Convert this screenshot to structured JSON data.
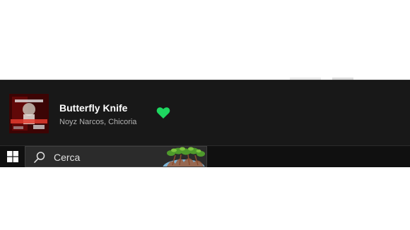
{
  "player": {
    "track_title": "Butterfly Knife",
    "track_artists": "Noyz Narcos, Chicoria",
    "liked": true,
    "like_color": "#1ed760",
    "album_art_icon": "album-cover"
  },
  "taskbar": {
    "start_icon": "windows-logo-icon",
    "search_placeholder": "Cerca",
    "search_icon": "search-icon",
    "search_highlight_icon": "search-highlight-illustration"
  },
  "colors": {
    "player_background": "#181818",
    "taskbar_background": "#101010",
    "search_background": "#2b2b2b",
    "accent": "#1ed760"
  }
}
